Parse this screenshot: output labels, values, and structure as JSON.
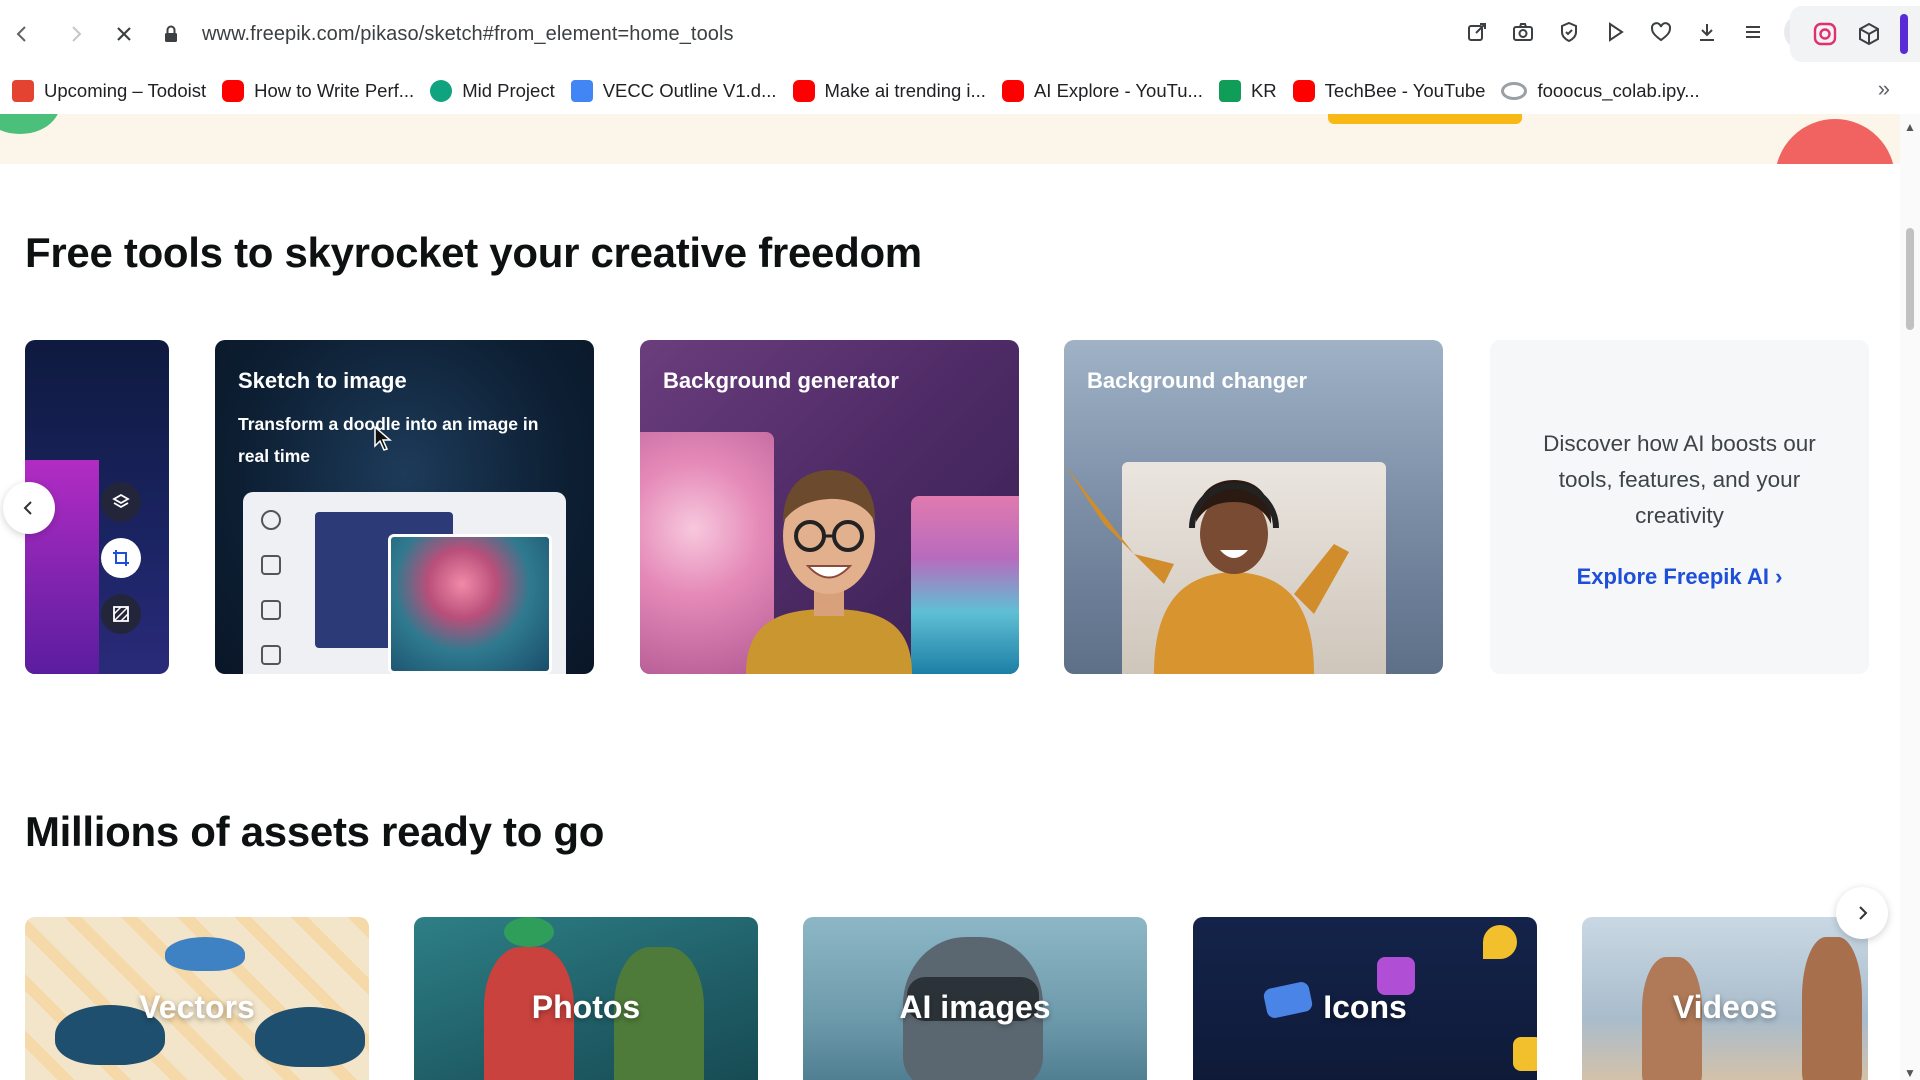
{
  "browser": {
    "url": "www.freepik.com/pikaso/sketch#from_element=home_tools",
    "bookmarks": [
      {
        "label": "Upcoming – Todoist",
        "color": "#e44332"
      },
      {
        "label": "How to Write Perf...",
        "color": "#ff0000"
      },
      {
        "label": "Mid Project",
        "color": "#10a37f"
      },
      {
        "label": "VECC Outline V1.d...",
        "color": "#4285f4"
      },
      {
        "label": "Make ai trending i...",
        "color": "#ff0000"
      },
      {
        "label": "AI Explore - YouTu...",
        "color": "#ff0000"
      },
      {
        "label": "KR",
        "color": "#0f9d58"
      },
      {
        "label": "TechBee - YouTube",
        "color": "#ff0000"
      },
      {
        "label": "fooocus_colab.ipy...",
        "color": "#9aa0a6"
      }
    ]
  },
  "tools_section": {
    "title": "Free tools to skyrocket your creative freedom",
    "cards": [
      {
        "title": "Sketch to image",
        "description": "Transform a doodle into an image in real time"
      },
      {
        "title": "Background generator"
      },
      {
        "title": "Background changer"
      }
    ],
    "discover": {
      "text": "Discover how AI boosts our tools, features, and your creativity",
      "link": "Explore Freepik AI ›"
    }
  },
  "assets_section": {
    "title": "Millions of assets ready to go",
    "categories": [
      "Vectors",
      "Photos",
      "AI images",
      "Icons",
      "Videos"
    ]
  },
  "colors": {
    "accent_link": "#1d4fd8",
    "banner_bg": "#fbf5ea",
    "extension_accent": "#5a2bd9"
  }
}
